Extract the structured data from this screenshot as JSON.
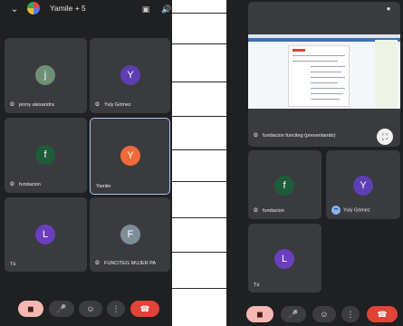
{
  "left": {
    "header": {
      "title": "Yamile + 5",
      "chevron_icon": "chevron-down-icon",
      "camera_switch_icon": "camera-switch-icon",
      "speaker_icon": "speaker-icon"
    },
    "tiles": [
      {
        "initial": "j",
        "name": "jenny alexandra",
        "color": "#6f8f77",
        "muted": true
      },
      {
        "initial": "Y",
        "name": "Yuly Gómez",
        "color": "#5e3fb3",
        "muted": true
      },
      {
        "initial": "f",
        "name": "fundacion",
        "color": "#1e5b3a",
        "muted": true
      },
      {
        "initial": "Y",
        "name": "Yamile",
        "color": "#ef6b3c",
        "muted": false,
        "active": true
      },
      {
        "initial": "L",
        "name": "Tú",
        "color": "#6a3fbf",
        "muted": false
      },
      {
        "initial": "F",
        "name": "FUNCITEG MUJER PA",
        "color": "#7d8e9a",
        "muted": true
      }
    ]
  },
  "right": {
    "presenter_label": "fundacion funciteg (presentando)",
    "tiles": [
      {
        "initial": "f",
        "name": "fundacion",
        "color": "#1e5b3a",
        "muted": true
      },
      {
        "initial": "Y",
        "name": "Yuly Gómez",
        "color": "#5e3fb3",
        "muted": false,
        "speaking": true
      },
      {
        "initial": "L",
        "name": "Tú",
        "color": "#6a3fbf",
        "muted": false
      }
    ]
  },
  "controls": {
    "camera_off_icon": "camera-off-icon",
    "mic_icon": "mic-icon",
    "emoji_icon": "emoji-icon",
    "more_icon": "more-vert-icon",
    "end_call_icon": "end-call-icon"
  },
  "colors": {
    "background": "#1f2022",
    "tile": "#3a3b3e",
    "active_border": "#a7c4f2",
    "end_call": "#e04436",
    "camera_off": "#f5b7b2"
  }
}
